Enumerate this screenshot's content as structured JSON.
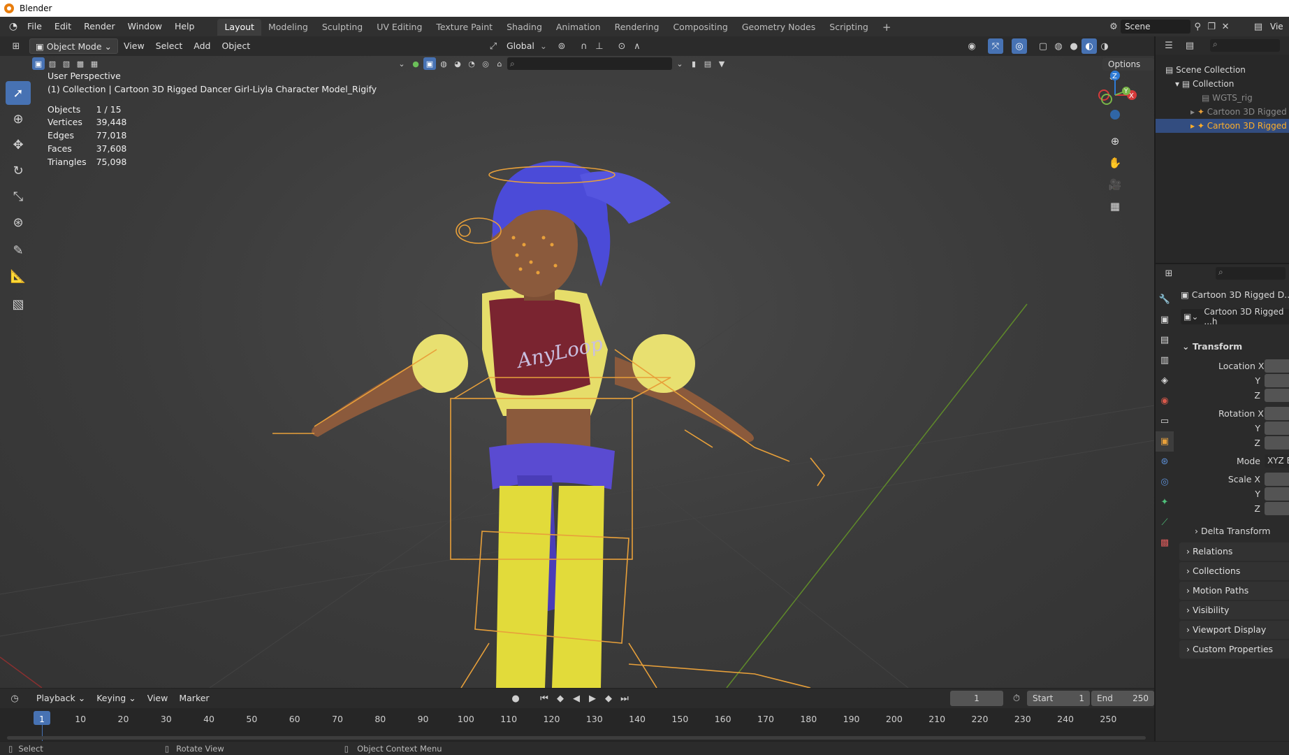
{
  "app": {
    "title": "Blender"
  },
  "menu": {
    "items": [
      "File",
      "Edit",
      "Render",
      "Window",
      "Help"
    ]
  },
  "workspaces": [
    "Layout",
    "Modeling",
    "Sculpting",
    "UV Editing",
    "Texture Paint",
    "Shading",
    "Animation",
    "Rendering",
    "Compositing",
    "Geometry Nodes",
    "Scripting"
  ],
  "active_workspace": "Layout",
  "scene": {
    "label": "Scene",
    "view_layer_label": "Vie"
  },
  "viewport_header": {
    "mode": "Object Mode",
    "menus": [
      "View",
      "Select",
      "Add",
      "Object"
    ],
    "orientation": "Global",
    "options_label": "Options"
  },
  "overlay_text": {
    "perspective": "User Perspective",
    "collection": "(1) Collection | Cartoon 3D Rigged Dancer Girl-Liyla Character Model_Rigify"
  },
  "stats": [
    {
      "label": "Objects",
      "value": "1 / 15"
    },
    {
      "label": "Vertices",
      "value": "39,448"
    },
    {
      "label": "Edges",
      "value": "77,018"
    },
    {
      "label": "Faces",
      "value": "37,608"
    },
    {
      "label": "Triangles",
      "value": "75,098"
    }
  ],
  "tools": [
    "select-box",
    "cursor",
    "move",
    "rotate",
    "scale",
    "transform",
    "annotate",
    "measure",
    "add-cube"
  ],
  "outliner": {
    "items": [
      {
        "label": "Scene Collection",
        "indent": 0
      },
      {
        "label": "Collection",
        "indent": 1
      },
      {
        "label": "WGTS_rig",
        "indent": 2
      },
      {
        "label": "Cartoon 3D Rigged D",
        "indent": 2
      },
      {
        "label": "Cartoon 3D Rigged D",
        "indent": 2,
        "selected": true
      }
    ]
  },
  "properties": {
    "object_name": "Cartoon 3D Rigged D...h",
    "data_name": "Cartoon 3D Rigged ...h",
    "transform_label": "Transform",
    "location_x": "Location X",
    "rotation_x": "Rotation X",
    "axis_y": "Y",
    "axis_z": "Z",
    "mode_label": "Mode",
    "mode_value": "XYZ E",
    "scale_x": "Scale X",
    "delta_transform": "Delta Transform",
    "panels": [
      "Relations",
      "Collections",
      "Motion Paths",
      "Visibility",
      "Viewport Display",
      "Custom Properties"
    ]
  },
  "timeline": {
    "menus": [
      "Playback",
      "Keying",
      "View",
      "Marker"
    ],
    "current_frame": "1",
    "start_label": "Start",
    "start_value": "1",
    "end_label": "End",
    "end_value": "250",
    "ticks": [
      "1",
      "10",
      "20",
      "30",
      "40",
      "50",
      "60",
      "70",
      "80",
      "90",
      "100",
      "110",
      "120",
      "130",
      "140",
      "150",
      "160",
      "170",
      "180",
      "190",
      "200",
      "210",
      "220",
      "230",
      "240",
      "250"
    ]
  },
  "statusbar": {
    "select": "Select",
    "rotate": "Rotate View",
    "context": "Object Context Menu"
  },
  "colors": {
    "accent": "#4772b3",
    "orange": "#e8a03a",
    "bg": "#3b3b3b"
  }
}
